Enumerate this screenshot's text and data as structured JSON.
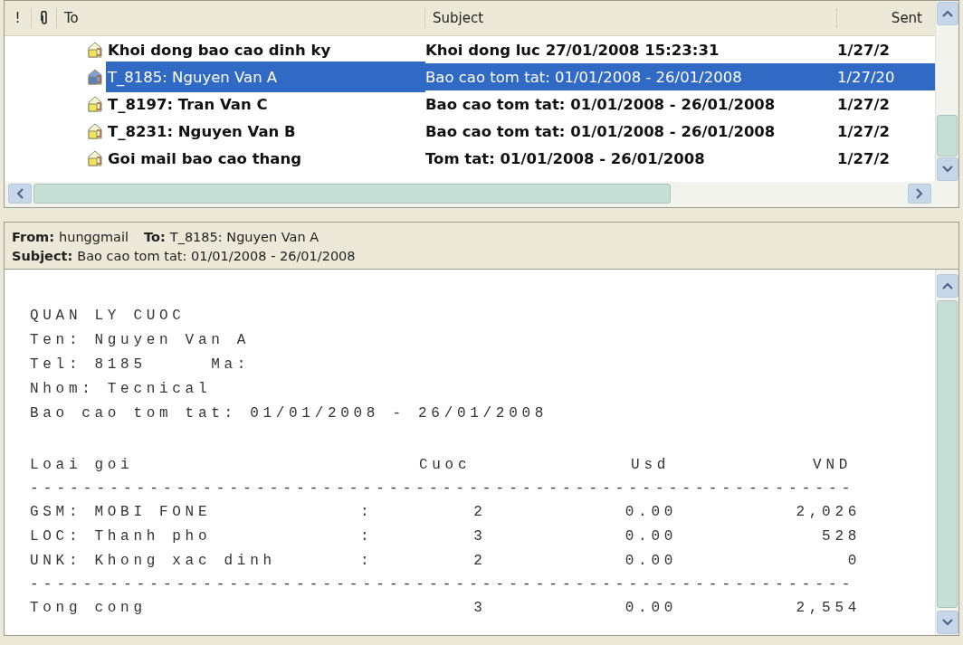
{
  "message_list": {
    "columns": [
      {
        "kind": "importance",
        "label": "!"
      },
      {
        "kind": "attachment"
      },
      {
        "kind": "to",
        "label": "To"
      },
      {
        "kind": "subject",
        "label": "Subject"
      },
      {
        "kind": "sent",
        "label": "Sent"
      }
    ],
    "rows": [
      {
        "to": "Khoi dong bao cao dinh ky",
        "subject": "Khoi dong luc 27/01/2008 15:23:31",
        "sent": "1/27/2",
        "selected": false,
        "unread": true
      },
      {
        "to": "T_8185: Nguyen Van A",
        "subject": "Bao cao tom tat: 01/01/2008 - 26/01/2008",
        "sent": "1/27/20",
        "selected": true,
        "unread": false
      },
      {
        "to": "T_8197: Tran Van C",
        "subject": "Bao cao tom tat: 01/01/2008 - 26/01/2008",
        "sent": "1/27/2",
        "selected": false,
        "unread": true
      },
      {
        "to": "T_8231: Nguyen Van B",
        "subject": "Bao cao tom tat: 01/01/2008 - 26/01/2008",
        "sent": "1/27/2",
        "selected": false,
        "unread": true
      },
      {
        "to": "Goi mail bao cao thang",
        "subject": "Tom tat: 01/01/2008 - 26/01/2008",
        "sent": "1/27/2",
        "selected": false,
        "unread": true
      }
    ]
  },
  "preview_header": {
    "from_label": "From:",
    "from": "hunggmail",
    "to_label": "To:",
    "to": "T_8185: Nguyen Van A",
    "subject_label": "Subject:",
    "subject": "Bao cao tom tat: 01/01/2008 - 26/01/2008"
  },
  "message_body": {
    "heading_lines": [
      "QUAN LY CUOC",
      "Ten: Nguyen Van A",
      "Tel: 8185     Ma:",
      "Nhom: Tecnical",
      "Bao cao tom tat: 01/01/2008 - 26/01/2008"
    ],
    "table": {
      "columns": [
        "Loai goi",
        "Cuoc",
        "Usd",
        "VND"
      ],
      "separator": "--------------------------------------------------------------",
      "rows": [
        {
          "label": "GSM: MOBI FONE",
          "sep": ":",
          "cuoc": "2",
          "usd": "0.00",
          "vnd": "2,026"
        },
        {
          "label": "LOC: Thanh pho",
          "sep": ":",
          "cuoc": "3",
          "usd": "0.00",
          "vnd": "528"
        },
        {
          "label": "UNK: Khong xac dinh",
          "sep": ":",
          "cuoc": "2",
          "usd": "0.00",
          "vnd": "0"
        }
      ],
      "total": {
        "label": "Tong cong",
        "cuoc": "3",
        "usd": "0.00",
        "vnd": "2,554"
      }
    }
  }
}
